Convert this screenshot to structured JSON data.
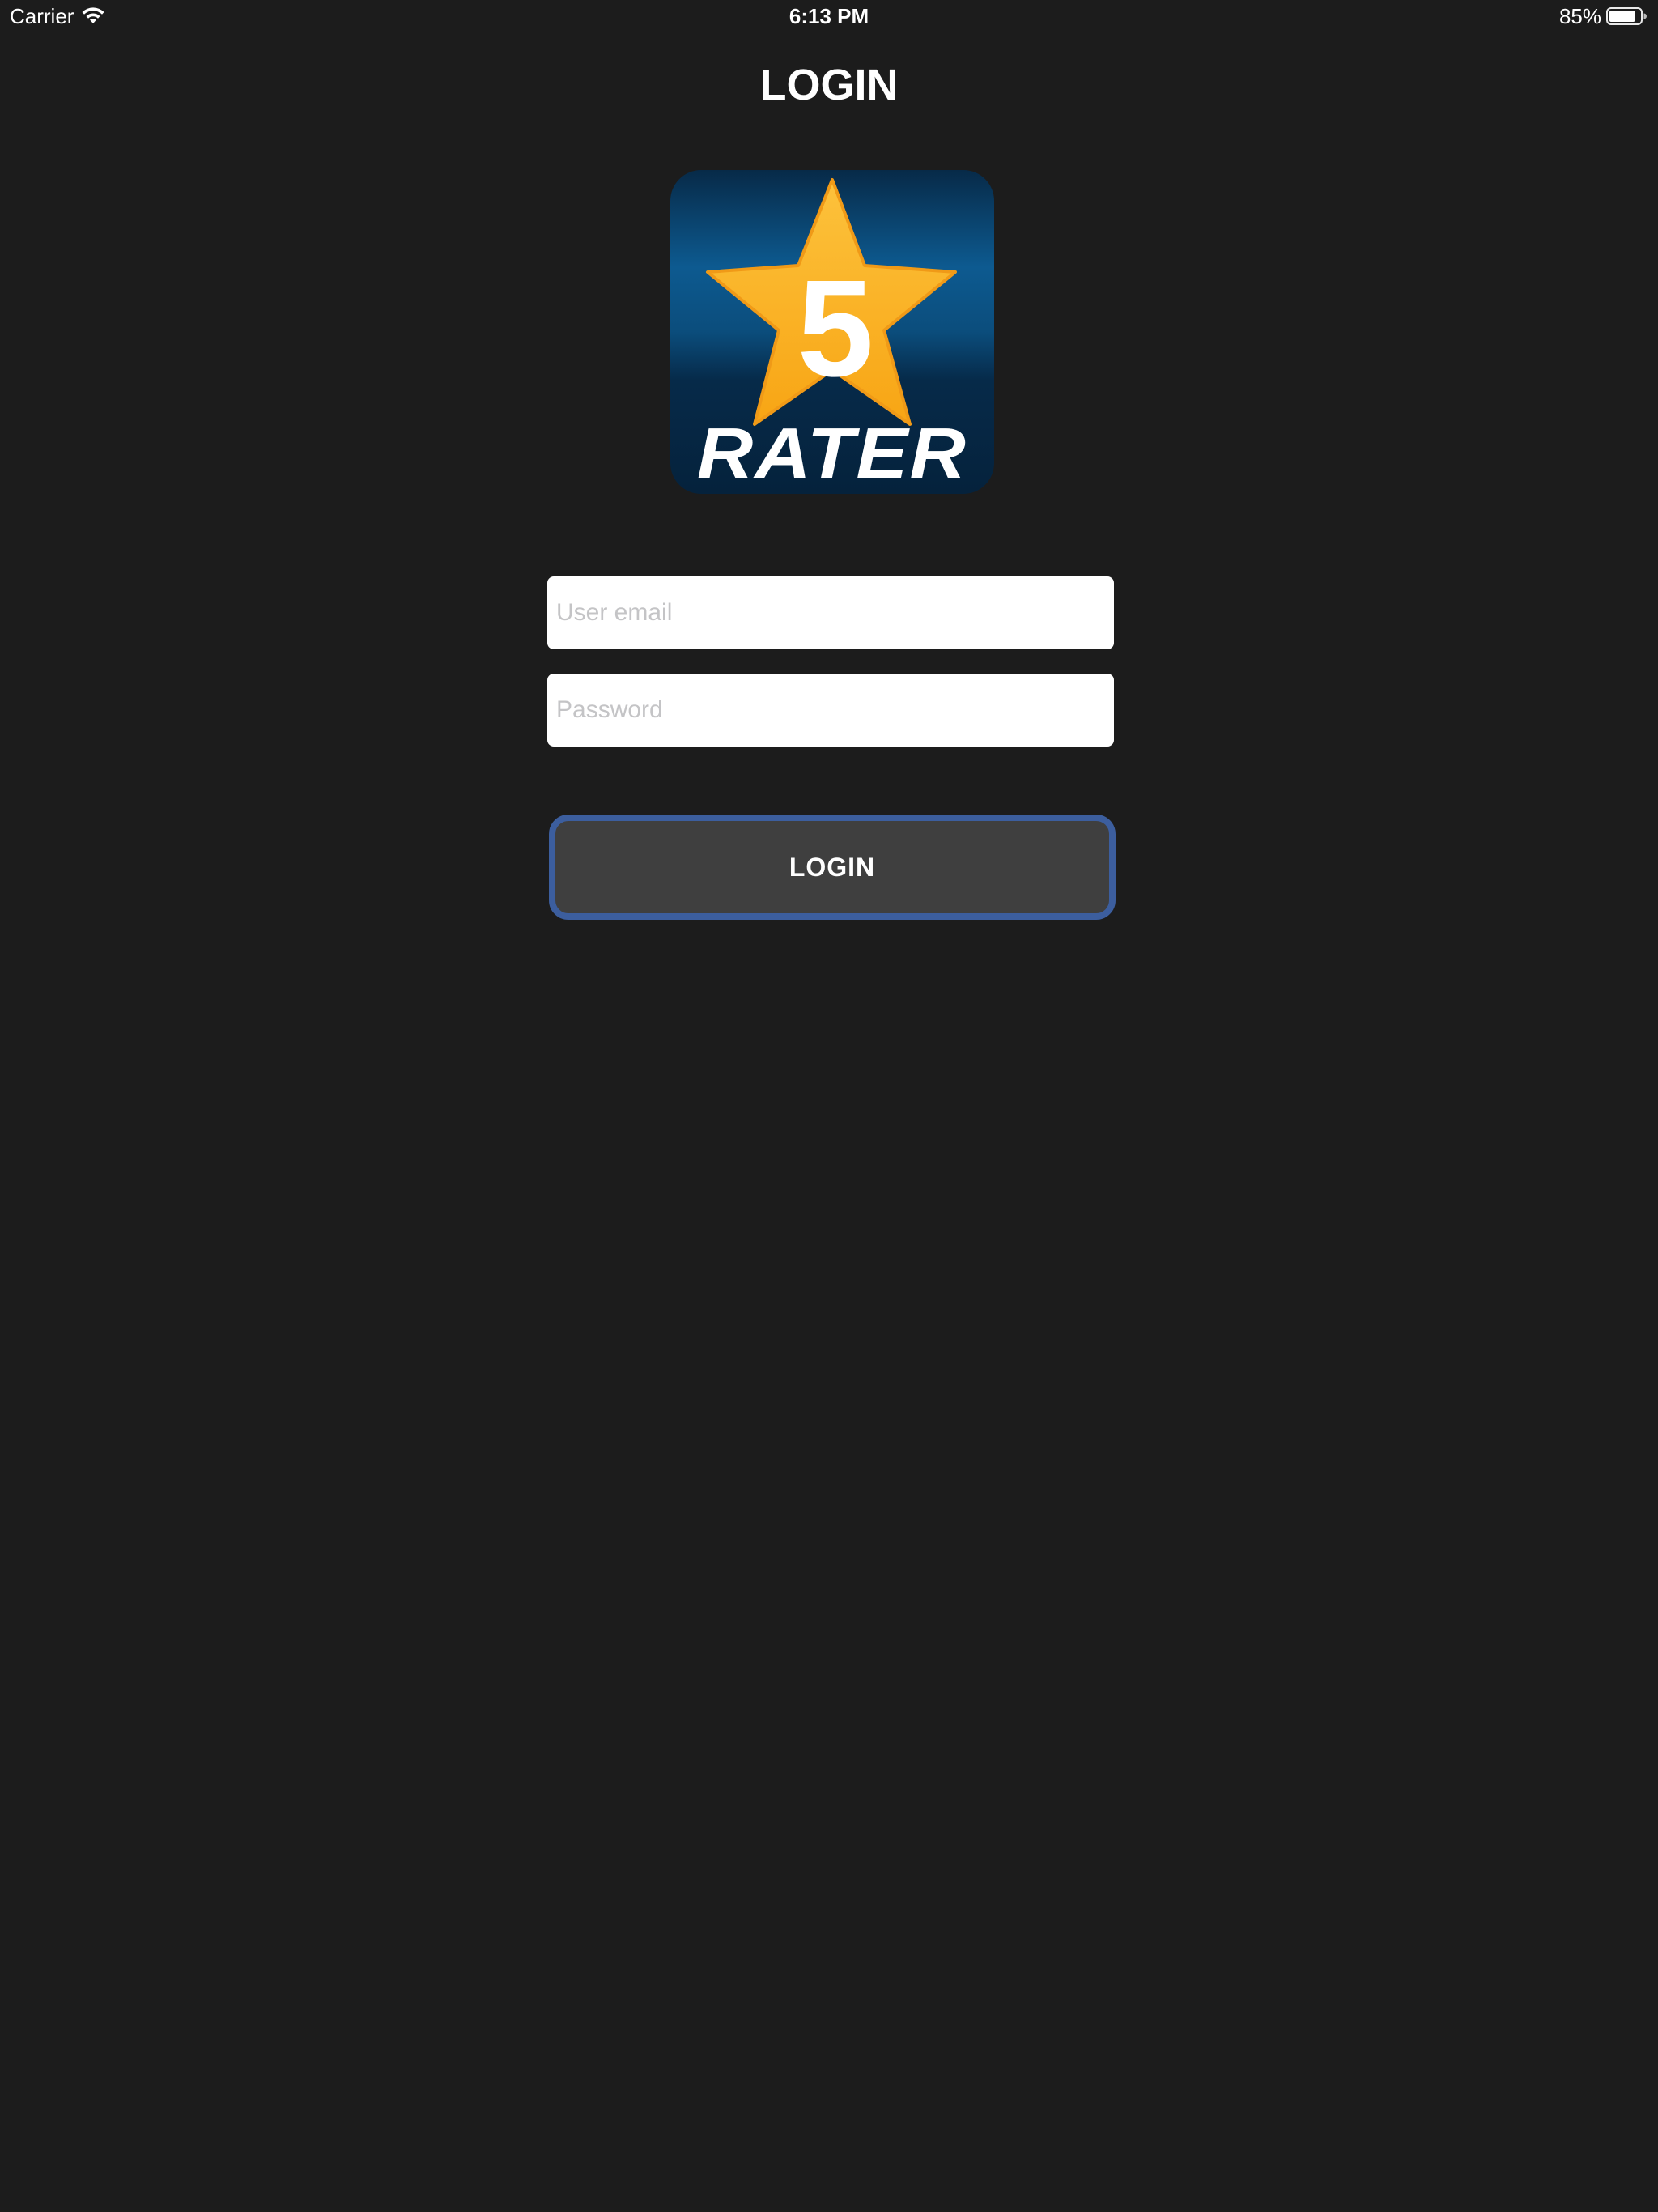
{
  "status_bar": {
    "carrier": "Carrier",
    "time": "6:13 PM",
    "battery_percent": "85%",
    "battery_level": 0.85,
    "wifi_icon": "wifi-icon",
    "battery_icon": "battery-icon"
  },
  "header": {
    "title": "LOGIN"
  },
  "logo": {
    "number": "5",
    "wordmark": "RATER",
    "colors": {
      "star": "#fbb524",
      "background_top": "#062a4a",
      "background_mid": "#0d5c92"
    }
  },
  "form": {
    "email_placeholder": "User email",
    "email_value": "",
    "password_placeholder": "Password",
    "password_value": ""
  },
  "login_button": {
    "label": "LOGIN"
  },
  "colors": {
    "background": "#1c1c1c",
    "button_fill": "#3f3f3f",
    "button_border": "#3c5e9e",
    "field_background": "#ffffff"
  }
}
